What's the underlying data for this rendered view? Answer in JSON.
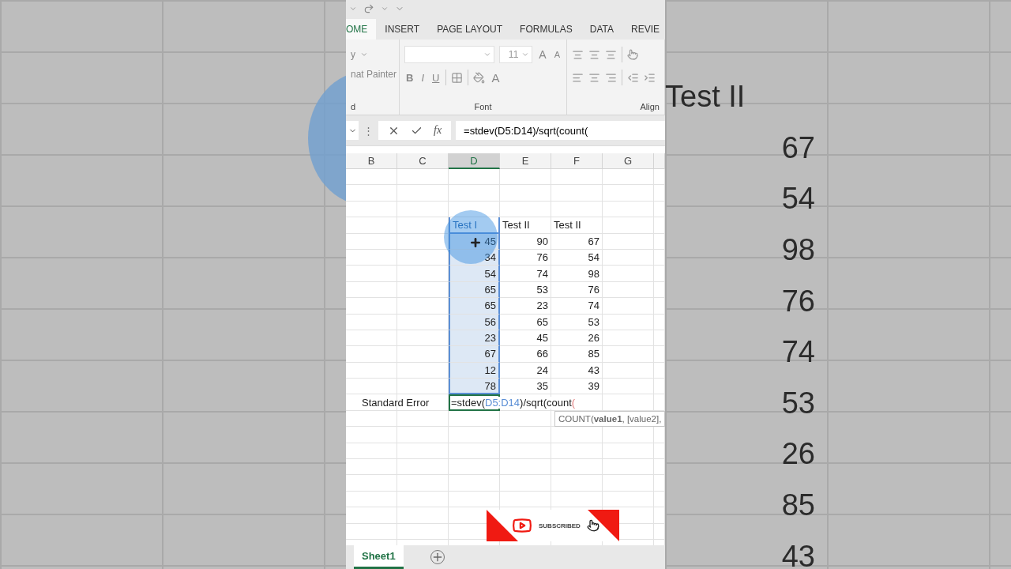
{
  "ribbon_tabs": [
    {
      "label": "OME",
      "selected": true
    },
    {
      "label": "INSERT",
      "selected": false
    },
    {
      "label": "PAGE LAYOUT",
      "selected": false
    },
    {
      "label": "FORMULAS",
      "selected": false
    },
    {
      "label": "DATA",
      "selected": false
    },
    {
      "label": "REVIE",
      "selected": false
    }
  ],
  "clipboard_group": {
    "items": [
      "y",
      "nat Painter"
    ],
    "label": "d"
  },
  "font_group": {
    "font_size": "11",
    "grow": "A",
    "shrink": "A",
    "bold": "B",
    "italic": "I",
    "underline": "U",
    "font_color": "A",
    "label": "Font"
  },
  "alignment_group": {
    "label": "Align"
  },
  "formula_bar": {
    "more": "⋮",
    "fx": "fx",
    "formula": "=stdev(D5:D14)/sqrt(count("
  },
  "columns": [
    {
      "label": "B",
      "selected": false
    },
    {
      "label": "C",
      "selected": false
    },
    {
      "label": "D",
      "selected": true
    },
    {
      "label": "E",
      "selected": false
    },
    {
      "label": "F",
      "selected": false
    },
    {
      "label": "G",
      "selected": false
    }
  ],
  "data_columns": [
    {
      "header": "Test I",
      "selected": true,
      "values": [
        "45",
        "34",
        "54",
        "65",
        "65",
        "56",
        "23",
        "67",
        "12",
        "78"
      ]
    },
    {
      "header": "Test II",
      "selected": false,
      "values": [
        "90",
        "76",
        "74",
        "53",
        "23",
        "65",
        "45",
        "66",
        "24",
        "35"
      ]
    },
    {
      "header": "Test II",
      "selected": false,
      "values": [
        "67",
        "54",
        "98",
        "76",
        "74",
        "53",
        "26",
        "85",
        "43",
        "39"
      ]
    }
  ],
  "result_row": {
    "label": "Standard Error",
    "formula": [
      {
        "text": "=stdev(",
        "kind": "plain"
      },
      {
        "text": "D5:D14",
        "kind": "ref"
      },
      {
        "text": ")/sqrt(count",
        "kind": "plain"
      },
      {
        "text": "(",
        "kind": "open"
      }
    ]
  },
  "tooltip": {
    "text": "COUNT(**value1**, [value2],"
  },
  "sheet_tabs": [
    {
      "label": "Sheet1",
      "selected": true
    }
  ],
  "overlay": {
    "label": "SUBSCRIBED"
  },
  "backdrop": {
    "header": "Test II",
    "values": [
      "67",
      "54",
      "98",
      "76",
      "74",
      "53",
      "26",
      "85",
      "43"
    ]
  }
}
